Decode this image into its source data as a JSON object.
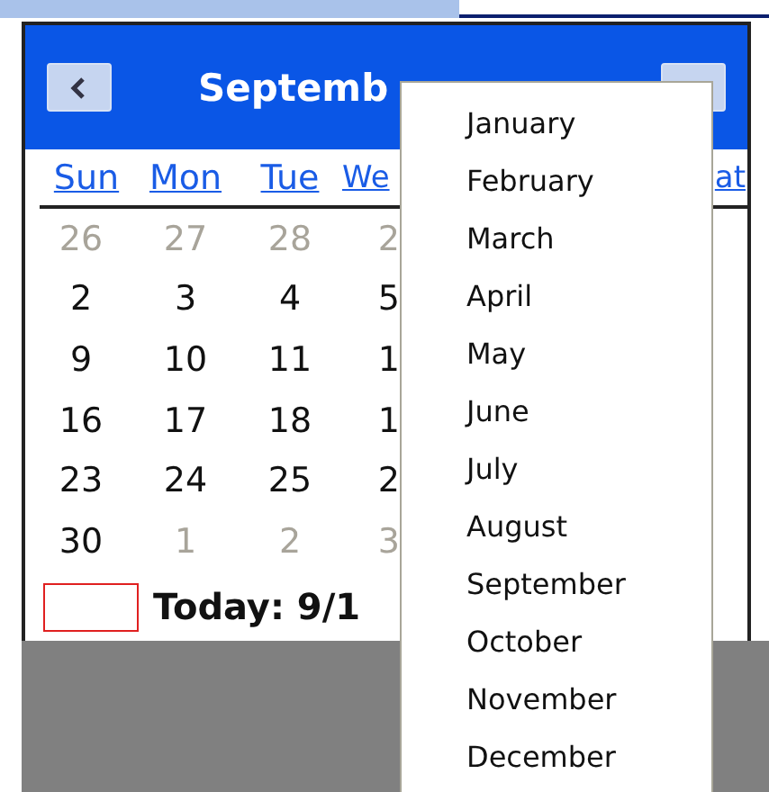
{
  "calendar": {
    "title": "Septemb",
    "weekdays": [
      {
        "label": "Sun"
      },
      {
        "label": "Mon"
      },
      {
        "label": "Tue"
      },
      {
        "label": "We"
      }
    ],
    "weekday_right": "at",
    "weeks": [
      [
        {
          "day": "26",
          "other_month": true
        },
        {
          "day": "27",
          "other_month": true
        },
        {
          "day": "28",
          "other_month": true
        },
        {
          "day": "2",
          "other_month": true
        }
      ],
      [
        {
          "day": "2",
          "other_month": false
        },
        {
          "day": "3",
          "other_month": false
        },
        {
          "day": "4",
          "other_month": false
        },
        {
          "day": "5",
          "other_month": false
        }
      ],
      [
        {
          "day": "9",
          "other_month": false
        },
        {
          "day": "10",
          "other_month": false
        },
        {
          "day": "11",
          "other_month": false
        },
        {
          "day": "1",
          "other_month": false
        }
      ],
      [
        {
          "day": "16",
          "other_month": false
        },
        {
          "day": "17",
          "other_month": false
        },
        {
          "day": "18",
          "other_month": false
        },
        {
          "day": "1",
          "other_month": false
        }
      ],
      [
        {
          "day": "23",
          "other_month": false
        },
        {
          "day": "24",
          "other_month": false
        },
        {
          "day": "25",
          "other_month": false
        },
        {
          "day": "2",
          "other_month": false
        }
      ],
      [
        {
          "day": "30",
          "other_month": false
        },
        {
          "day": "1",
          "other_month": true
        },
        {
          "day": "2",
          "other_month": true
        },
        {
          "day": "3",
          "other_month": true
        }
      ]
    ],
    "today_label": "Today: 9/1"
  },
  "month_menu": {
    "items": [
      "January",
      "February",
      "March",
      "April",
      "May",
      "June",
      "July",
      "August",
      "September",
      "October",
      "November",
      "December"
    ]
  }
}
